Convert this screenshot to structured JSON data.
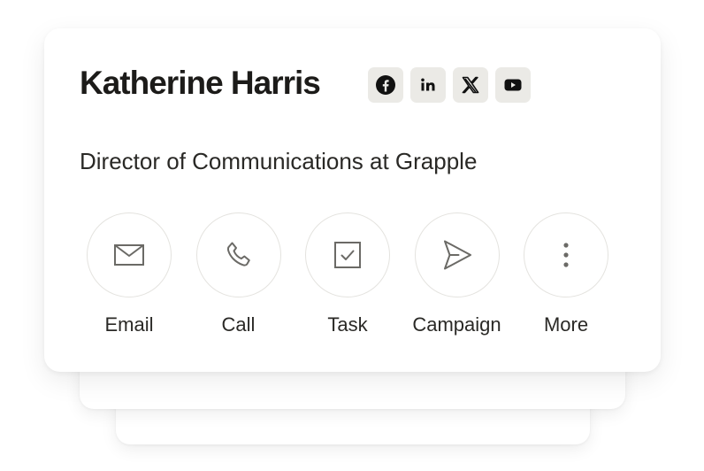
{
  "contact": {
    "name": "Katherine Harris",
    "title": "Director of Communications at Grapple"
  },
  "socials": [
    {
      "icon": "facebook-icon",
      "label": "Facebook"
    },
    {
      "icon": "linkedin-icon",
      "label": "LinkedIn"
    },
    {
      "icon": "x-icon",
      "label": "X"
    },
    {
      "icon": "youtube-icon",
      "label": "YouTube"
    }
  ],
  "actions": [
    {
      "icon": "envelope-icon",
      "label": "Email"
    },
    {
      "icon": "phone-icon",
      "label": "Call"
    },
    {
      "icon": "checkbox-icon",
      "label": "Task"
    },
    {
      "icon": "send-icon",
      "label": "Campaign"
    },
    {
      "icon": "more-vertical-icon",
      "label": "More"
    }
  ],
  "colors": {
    "text": "#1c1b19",
    "icon_chip": "#ebeae6",
    "circle_border": "#e4e3df",
    "icon_stroke": "#6b6a66"
  }
}
